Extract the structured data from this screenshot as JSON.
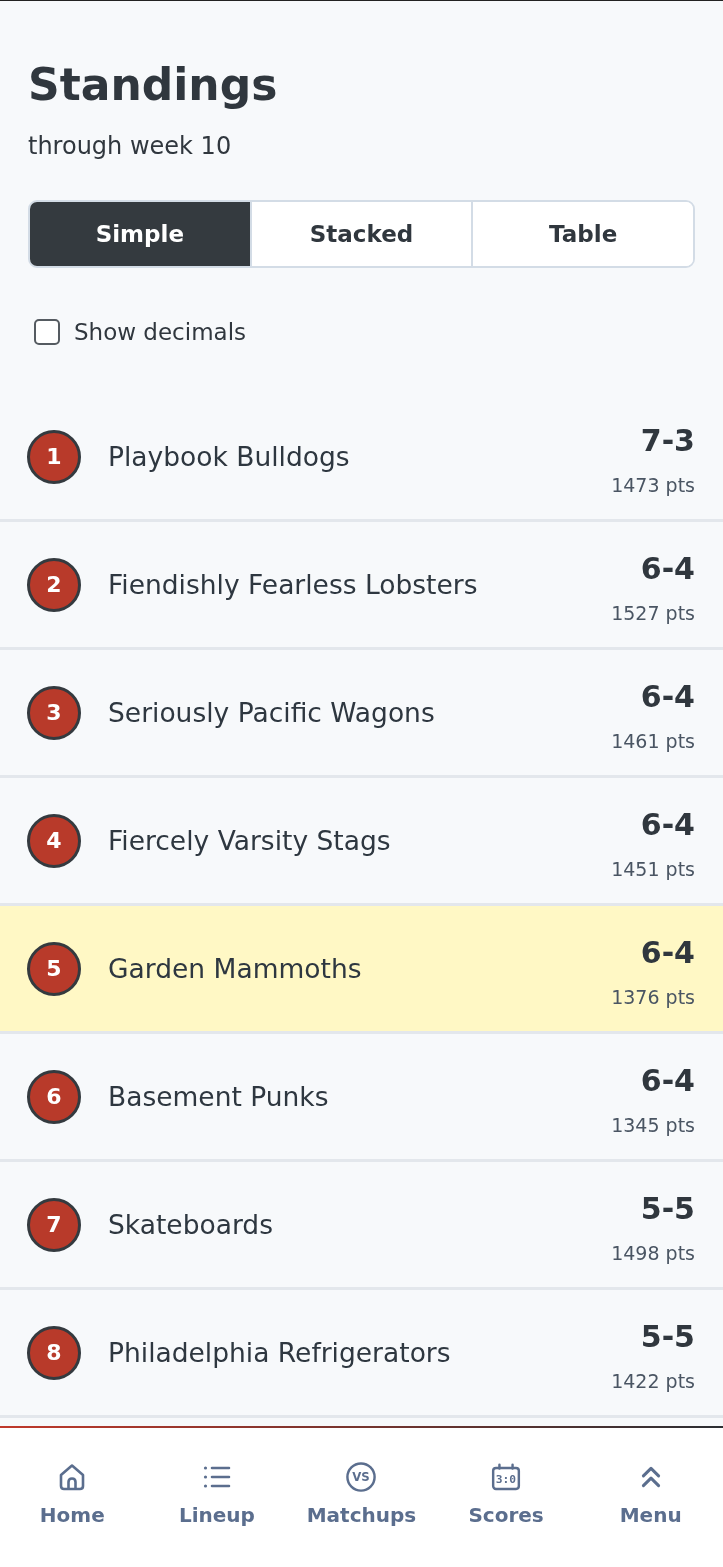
{
  "header": {
    "title": "Standings",
    "subtitle": "through week 10"
  },
  "view_tabs": [
    {
      "label": "Simple",
      "selected": true
    },
    {
      "label": "Stacked",
      "selected": false
    },
    {
      "label": "Table",
      "selected": false
    }
  ],
  "options": [
    {
      "label": "Show decimals",
      "checked": false
    }
  ],
  "teams": [
    {
      "rank": "1",
      "name": "Playbook Bulldogs",
      "record": "7-3",
      "points": "1473 pts",
      "highlighted": false
    },
    {
      "rank": "2",
      "name": "Fiendishly Fearless Lobsters",
      "record": "6-4",
      "points": "1527 pts",
      "highlighted": false
    },
    {
      "rank": "3",
      "name": "Seriously Pacific Wagons",
      "record": "6-4",
      "points": "1461 pts",
      "highlighted": false
    },
    {
      "rank": "4",
      "name": "Fiercely Varsity Stags",
      "record": "6-4",
      "points": "1451 pts",
      "highlighted": false
    },
    {
      "rank": "5",
      "name": "Garden Mammoths",
      "record": "6-4",
      "points": "1376 pts",
      "highlighted": true
    },
    {
      "rank": "6",
      "name": "Basement Punks",
      "record": "6-4",
      "points": "1345 pts",
      "highlighted": false
    },
    {
      "rank": "7",
      "name": "Skateboards",
      "record": "5-5",
      "points": "1498 pts",
      "highlighted": false
    },
    {
      "rank": "8",
      "name": "Philadelphia Refrigerators",
      "record": "5-5",
      "points": "1422 pts",
      "highlighted": false
    }
  ],
  "bottom_nav": [
    {
      "label": "Home"
    },
    {
      "label": "Lineup"
    },
    {
      "label": "Matchups",
      "icon_text": "VS"
    },
    {
      "label": "Scores",
      "icon_text": "3:0"
    },
    {
      "label": "Menu"
    }
  ]
}
